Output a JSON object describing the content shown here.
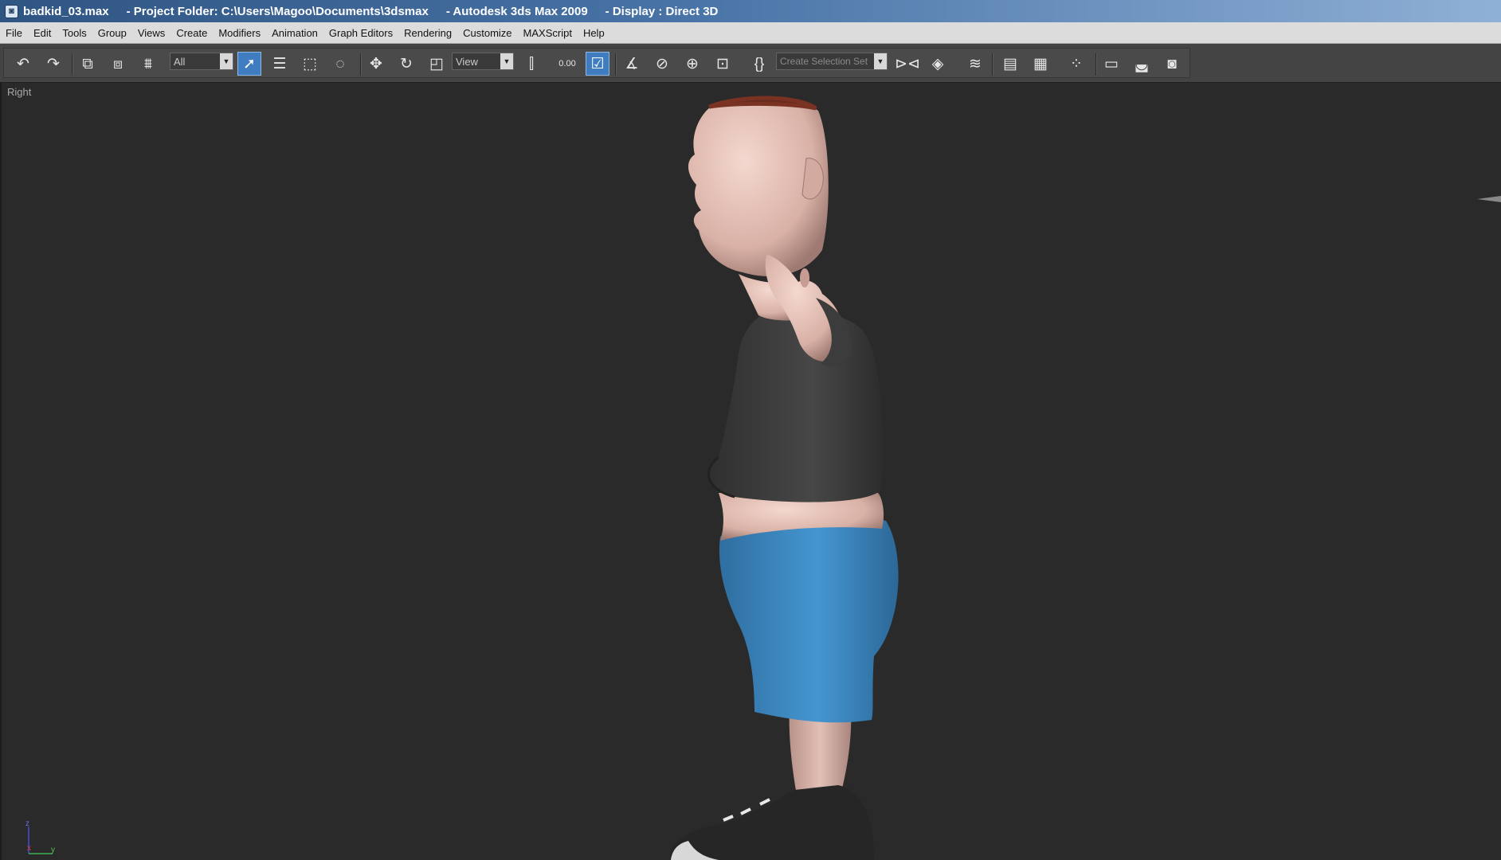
{
  "window": {
    "file": "badkid_03.max",
    "project": "- Project Folder: C:\\Users\\Magoo\\Documents\\3dsmax",
    "app": "- Autodesk 3ds Max  2009",
    "display": "- Display : Direct 3D",
    "icon": "3ds-max-app-icon"
  },
  "menu": [
    "File",
    "Edit",
    "Tools",
    "Group",
    "Views",
    "Create",
    "Modifiers",
    "Animation",
    "Graph Editors",
    "Rendering",
    "Customize",
    "MAXScript",
    "Help"
  ],
  "toolbar": {
    "selection_filter": "All",
    "reference_coord": "View",
    "spinner_snap_value": "0.00",
    "named_selection_placeholder": "Create Selection Set",
    "icons": [
      "undo-icon",
      "redo-icon",
      "select-and-link-icon",
      "unlink-selection-icon",
      "bind-to-space-warp-icon",
      "select-object-icon",
      "select-by-name-icon",
      "rectangular-selection-icon",
      "window-crossing-icon",
      "move-icon",
      "rotate-icon",
      "scale-icon",
      "pivot-center-icon",
      "keyboard-shortcut-override-icon",
      "snaps-toggle-icon",
      "angle-snap-icon",
      "percent-snap-icon",
      "spinner-snap-icon",
      "edit-named-selection-icon",
      "mirror-icon",
      "align-icon",
      "layer-manager-icon",
      "curve-editor-icon",
      "schematic-view-icon",
      "material-editor-icon",
      "render-setup-icon",
      "rendered-frame-window-icon",
      "quick-render-icon"
    ]
  },
  "viewport": {
    "label": "Right",
    "background": "#2a2a2a",
    "axis": {
      "z": "z",
      "x": "x",
      "y": "y"
    }
  },
  "scene": {
    "character": "badkid cartoon character, right side view",
    "colors": {
      "skin": "#e6c2b8",
      "shirt": "#3d3d3d",
      "shorts": "#3f8fc9",
      "shoe": "#262626",
      "hair": "#6a2a1c"
    }
  }
}
